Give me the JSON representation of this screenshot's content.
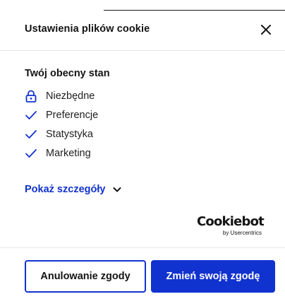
{
  "header": {
    "title": "Ustawienia plików cookie",
    "close_icon": "close-icon"
  },
  "status": {
    "title": "Twój obecny stan",
    "items": [
      {
        "label": "Niezbędne",
        "icon": "lock-icon"
      },
      {
        "label": "Preferencje",
        "icon": "check-icon"
      },
      {
        "label": "Statystyka",
        "icon": "check-icon"
      },
      {
        "label": "Marketing",
        "icon": "check-icon"
      }
    ]
  },
  "details": {
    "label": "Pokaż szczegóły",
    "icon": "chevron-down-icon"
  },
  "brand": {
    "name": "Cookiebot",
    "sub": "by Usercentrics"
  },
  "footer": {
    "withdraw_label": "Anulowanie zgody",
    "change_label": "Zmień swoją zgodę"
  },
  "colors": {
    "accent": "#1032cf",
    "text": "#141414",
    "divider": "#e6e6e6"
  }
}
